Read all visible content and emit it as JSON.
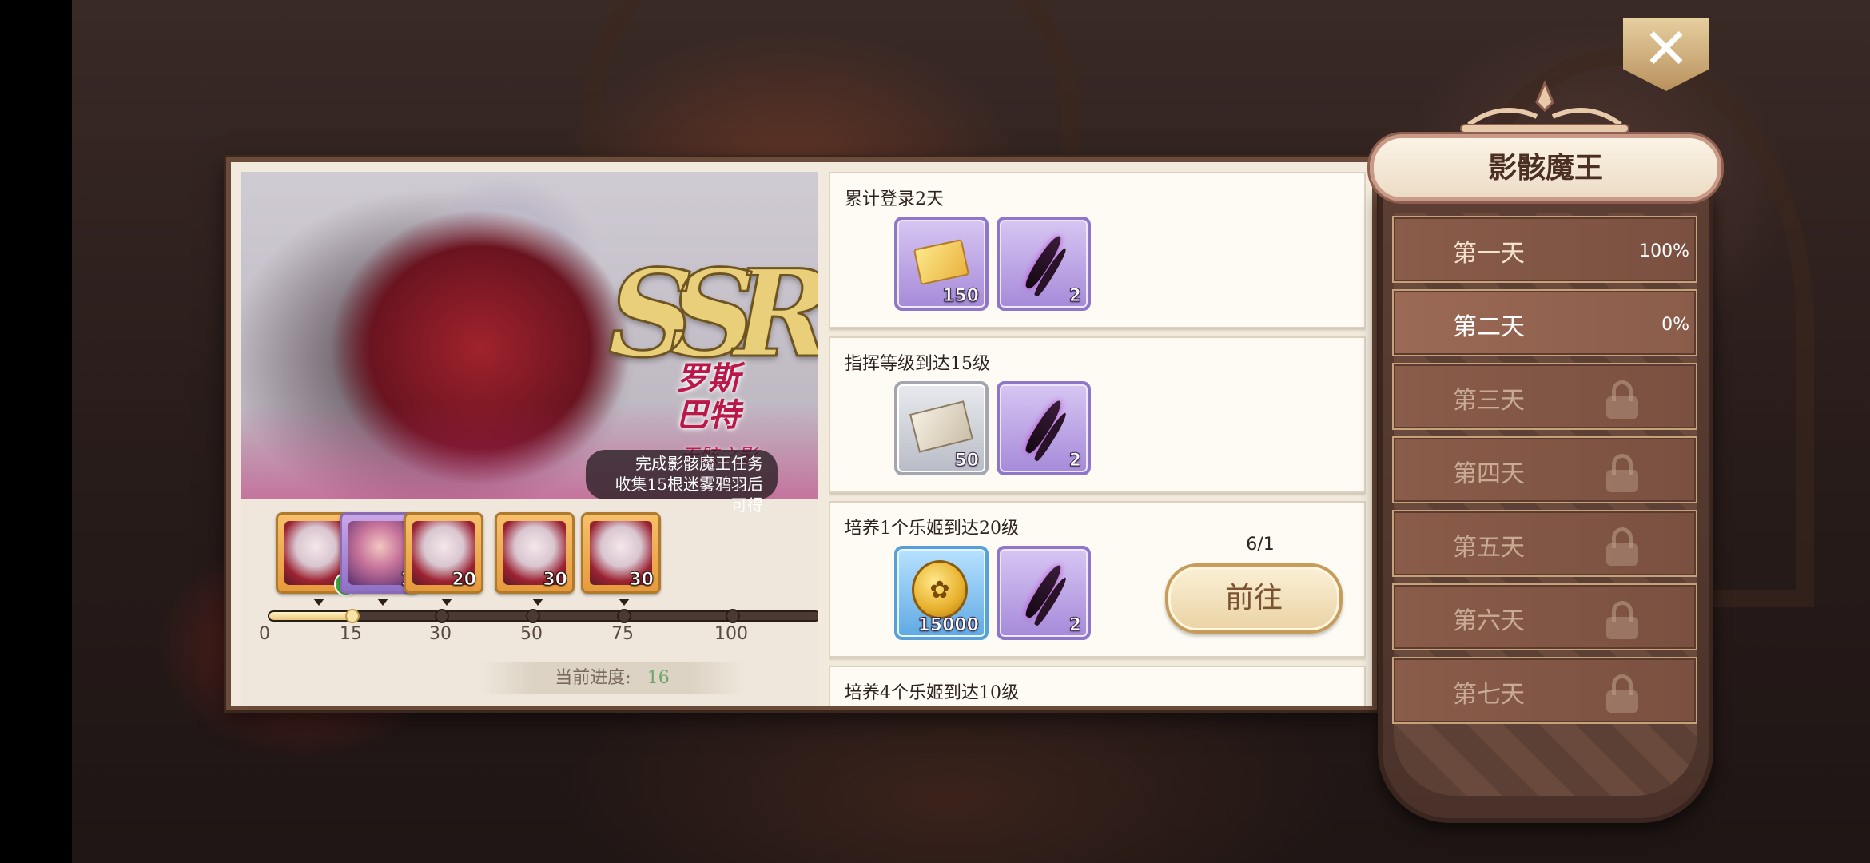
{
  "close_icon": "close-x-icon",
  "character": {
    "rarity": "SSR",
    "name": "罗斯巴特",
    "title": "无骸之影",
    "hint_line1": "完成影骸魔王任务",
    "hint_line2": "收集15根迷雾鸦羽后可得"
  },
  "progress": {
    "label": "当前进度:",
    "value": "16",
    "current": 16,
    "max": 100,
    "ticks": [
      "0",
      "15",
      "30",
      "50",
      "75",
      "100"
    ],
    "milestones": [
      {
        "count": "",
        "claimed": true,
        "style": "gold"
      },
      {
        "count": "1",
        "claimed": false,
        "style": "purple"
      },
      {
        "count": "20",
        "claimed": false,
        "style": "gold"
      },
      {
        "count": "30",
        "claimed": false,
        "style": "gold"
      },
      {
        "count": "30",
        "claimed": false,
        "style": "gold"
      }
    ]
  },
  "tasks": [
    {
      "title": "累计登录2天",
      "rewards": [
        {
          "icon": "ticket-icon",
          "count": "150"
        },
        {
          "icon": "raven-feather-icon",
          "count": "2"
        }
      ]
    },
    {
      "title": "指挥等级到达15级",
      "rewards": [
        {
          "icon": "book-quill-icon",
          "count": "50"
        },
        {
          "icon": "raven-feather-icon",
          "count": "2"
        }
      ]
    },
    {
      "title": "培养1个乐姬到达20级",
      "rewards": [
        {
          "icon": "gold-coin-icon",
          "count": "15000"
        },
        {
          "icon": "raven-feather-icon",
          "count": "2"
        }
      ],
      "count": "6/1",
      "button": "前往"
    },
    {
      "title": "培养4个乐姬到达10级"
    }
  ],
  "side": {
    "title": "影骸魔王",
    "days": [
      {
        "label": "第一天",
        "pct": "100%",
        "locked": false
      },
      {
        "label": "第二天",
        "pct": "0%",
        "locked": false
      },
      {
        "label": "第三天",
        "locked": true
      },
      {
        "label": "第四天",
        "locked": true
      },
      {
        "label": "第五天",
        "locked": true
      },
      {
        "label": "第六天",
        "locked": true
      },
      {
        "label": "第七天",
        "locked": true
      }
    ]
  },
  "colors": {
    "accent_gold": "#e9cf7a",
    "name_red": "#b91849",
    "progress_green": "#6fa56d"
  }
}
